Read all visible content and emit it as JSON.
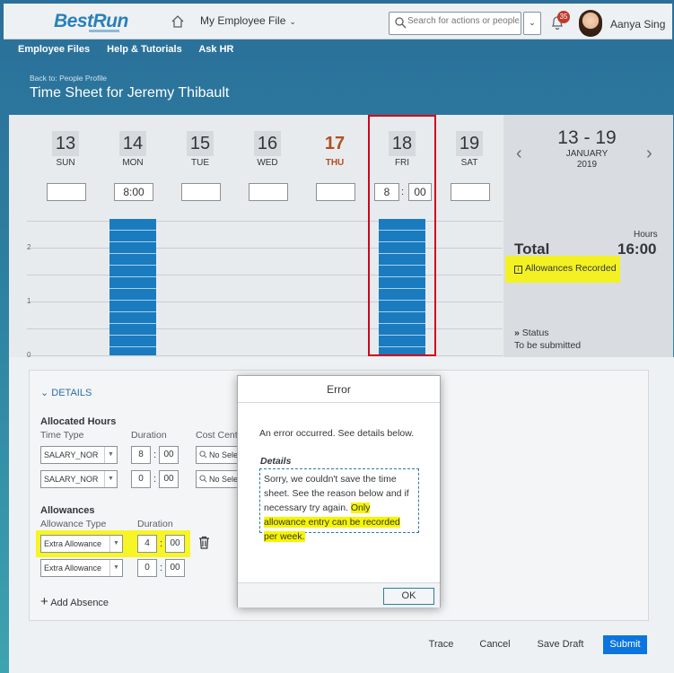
{
  "shell": {
    "logo": "BestRun",
    "app_title": "My Employee File",
    "search_placeholder": "Search for actions or people",
    "notification_count": "35",
    "user_name": "Aanya Sing"
  },
  "subnav": {
    "items": [
      "Employee Files",
      "Help & Tutorials",
      "Ask HR"
    ]
  },
  "header": {
    "back": "Back to: People Profile",
    "title": "Time Sheet for Jeremy Thibault"
  },
  "days": [
    {
      "num": "13",
      "name": "SUN",
      "hours": ""
    },
    {
      "num": "14",
      "name": "MON",
      "hours": "8:00"
    },
    {
      "num": "15",
      "name": "TUE",
      "hours": ""
    },
    {
      "num": "16",
      "name": "WED",
      "hours": ""
    },
    {
      "num": "17",
      "name": "THU",
      "hours": ""
    },
    {
      "num": "18",
      "name": "FRI",
      "hours_h": "8",
      "hours_m": "00"
    },
    {
      "num": "19",
      "name": "SAT",
      "hours": ""
    }
  ],
  "chart_data": {
    "type": "bar",
    "categories": [
      "SUN",
      "MON",
      "TUE",
      "WED",
      "THU",
      "FRI",
      "SAT"
    ],
    "values": [
      0,
      8,
      0,
      0,
      0,
      8,
      0
    ],
    "y_ticks": [
      "0",
      "1",
      "2"
    ]
  },
  "summary": {
    "range": "13 - 19",
    "month": "JANUARY",
    "year": "2019",
    "hours_label": "Hours",
    "total_label": "Total",
    "total_value": "16:00",
    "allowances_recorded": "Allowances Recorded",
    "status_label": "Status",
    "status_value": "To be submitted"
  },
  "details": {
    "header": "DETAILS",
    "allocated_title": "Allocated Hours",
    "col_time_type": "Time Type",
    "col_duration": "Duration",
    "col_cost_center": "Cost Cent",
    "allocated_rows": [
      {
        "type": "SALARY_NOR",
        "h": "8",
        "m": "00",
        "cc": "No Sele"
      },
      {
        "type": "SALARY_NOR",
        "h": "0",
        "m": "00",
        "cc": "No Sele"
      }
    ],
    "allowances_title": "Allowances",
    "col_allowance_type": "Allowance Type",
    "col_allow_duration": "Duration",
    "allowance_rows": [
      {
        "type": "Extra Allowance",
        "h": "4",
        "m": "00"
      },
      {
        "type": "Extra Allowance",
        "h": "0",
        "m": "00"
      }
    ],
    "add_absence": "Add Absence"
  },
  "footer": {
    "trace": "Trace",
    "cancel": "Cancel",
    "save_draft": "Save Draft",
    "submit": "Submit"
  },
  "dialog": {
    "title": "Error",
    "message": "An error occurred. See details below.",
    "details_label": "Details",
    "details_text": "Sorry, we couldn't save the time sheet. See the reason below and if necessary try again.",
    "details_highlight": "Only allowance entry can be recorded per week.",
    "ok": "OK"
  }
}
